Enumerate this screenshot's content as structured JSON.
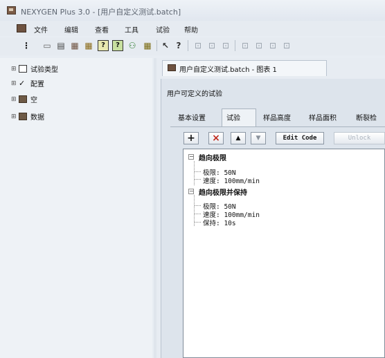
{
  "window": {
    "title": "NEXYGEN Plus 3.0 - [用户自定义测试.batch]"
  },
  "menu": {
    "items": [
      "文件",
      "编辑",
      "查看",
      "工具",
      "试验",
      "帮助"
    ]
  },
  "toolbar": {
    "buttons": [
      {
        "icon": "drag-handle-icon",
        "glyph": "⋮"
      },
      {
        "icon": "save-icon",
        "glyph": "▭"
      },
      {
        "icon": "print-icon",
        "glyph": "▤"
      },
      {
        "icon": "open-folder-icon",
        "glyph": "▦"
      },
      {
        "icon": "open-folder-icon",
        "glyph": "▦"
      },
      {
        "icon": "help-box-icon",
        "glyph": "?"
      },
      {
        "icon": "help-box-icon",
        "glyph": "?"
      },
      {
        "icon": "share-icon",
        "glyph": "⚇"
      },
      {
        "icon": "grid-icon",
        "glyph": "▦"
      },
      {
        "icon": "context-help-icon",
        "glyph": "↖"
      },
      {
        "icon": "help-icon",
        "glyph": "?"
      },
      {
        "icon": "disabled-tool-icon",
        "glyph": "⊡"
      },
      {
        "icon": "disabled-tool-icon",
        "glyph": "⊡"
      },
      {
        "icon": "disabled-tool-icon",
        "glyph": "⊡"
      },
      {
        "icon": "disabled-tool-icon",
        "glyph": "⊡"
      },
      {
        "icon": "disabled-tool-icon",
        "glyph": "⊡"
      },
      {
        "icon": "disabled-tool-icon",
        "glyph": "⊡"
      },
      {
        "icon": "disabled-tool-icon",
        "glyph": "⊡"
      }
    ]
  },
  "tree": {
    "items": [
      {
        "label": "试验类型",
        "icon": "test-type-icon",
        "expander": "⊞"
      },
      {
        "label": "配置",
        "icon": "checkmark-icon",
        "expander": "⊞"
      },
      {
        "label": "空",
        "icon": "folder-icon",
        "expander": "⊞"
      },
      {
        "label": "数据",
        "icon": "folder-icon",
        "expander": "⊞"
      }
    ]
  },
  "document": {
    "tab_label": "用户自定义测试.batch - 图表 1",
    "panel_title": "用户可定义的试验",
    "subtabs": [
      "基本设置",
      "试验",
      "样品高度",
      "样品面积",
      "断裂检"
    ],
    "active_subtab": 1,
    "buttons": {
      "add": "+",
      "delete": "×",
      "move_up": "▲",
      "move_down": "▼",
      "edit_code": "Edit Code",
      "unlock": "Unlock"
    },
    "stages": [
      {
        "name": "趋向极限",
        "params": [
          "极限: 50N",
          "速度: 100mm/min"
        ]
      },
      {
        "name": "趋向极限并保持",
        "params": [
          "极限: 50N",
          "速度: 100mm/min",
          "保持: 10s"
        ]
      }
    ]
  },
  "colors": {
    "window_bg": "#e8edf3",
    "accent_brown": "#6e5240"
  }
}
